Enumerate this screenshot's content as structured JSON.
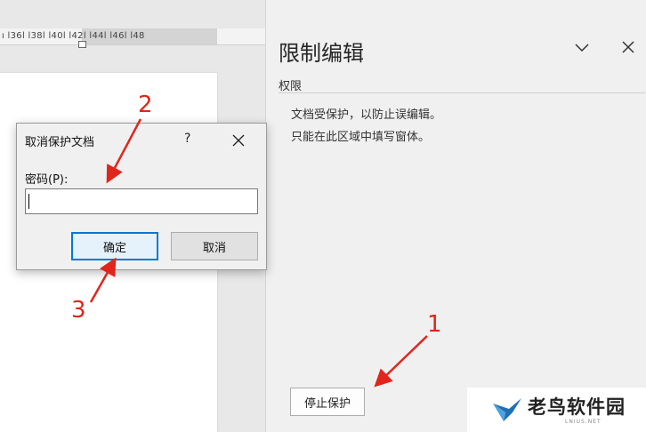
{
  "ruler": {
    "labels": "ı l36l l38l l40l l42l l44l l46l l48"
  },
  "panel": {
    "title": "限制编辑",
    "section": "权限",
    "line1": "文档受保护，以防止误编辑。",
    "line2": "只能在此区域中填写窗体。",
    "stop_button": "停止保护"
  },
  "dialog": {
    "title": "取消保护文档",
    "help": "?",
    "password_label": "密码(P):",
    "password_value": "",
    "ok_button": "确定",
    "cancel_button": "取消"
  },
  "annotations": {
    "n1": "1",
    "n2": "2",
    "n3": "3",
    "color": "#e0261c"
  },
  "watermark": {
    "text": "老鸟软件园",
    "sub": "LNIUS.NET"
  }
}
